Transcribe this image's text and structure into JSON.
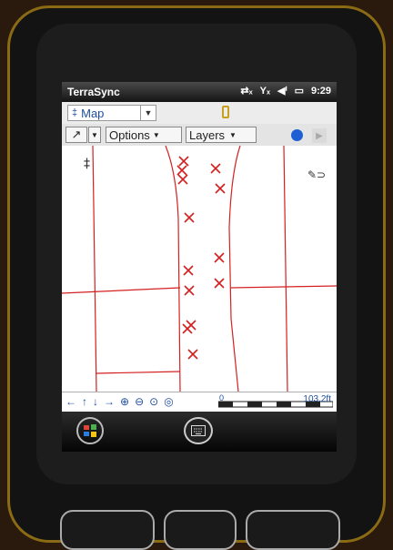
{
  "titlebar": {
    "app_name": "TerraSync",
    "time": "9:29",
    "icons": [
      "signal-disabled-icon",
      "antenna-disabled-icon",
      "volume-icon",
      "battery-icon"
    ]
  },
  "toolbar1": {
    "section_label": "Map",
    "section_icon": "map-pin-icon"
  },
  "toolbar2": {
    "options_label": "Options",
    "layers_label": "Layers",
    "select_tool_icon": "arrow-select-icon",
    "record_icon": "record-dot-icon",
    "play_icon": "play-icon"
  },
  "scalebar": {
    "nav_icons": [
      "pan-left-icon",
      "pan-up-icon",
      "pan-down-icon",
      "pan-right-icon",
      "zoom-in-icon",
      "zoom-out-icon",
      "zoom-extents-icon",
      "gps-center-icon"
    ],
    "zero_label": "0",
    "distance_label": "103.2ft"
  },
  "colors": {
    "feature_line": "#d42020",
    "accent_blue": "#1e4d9e",
    "record_blue": "#1f5fd6",
    "device_frame": "#8a6a12"
  }
}
